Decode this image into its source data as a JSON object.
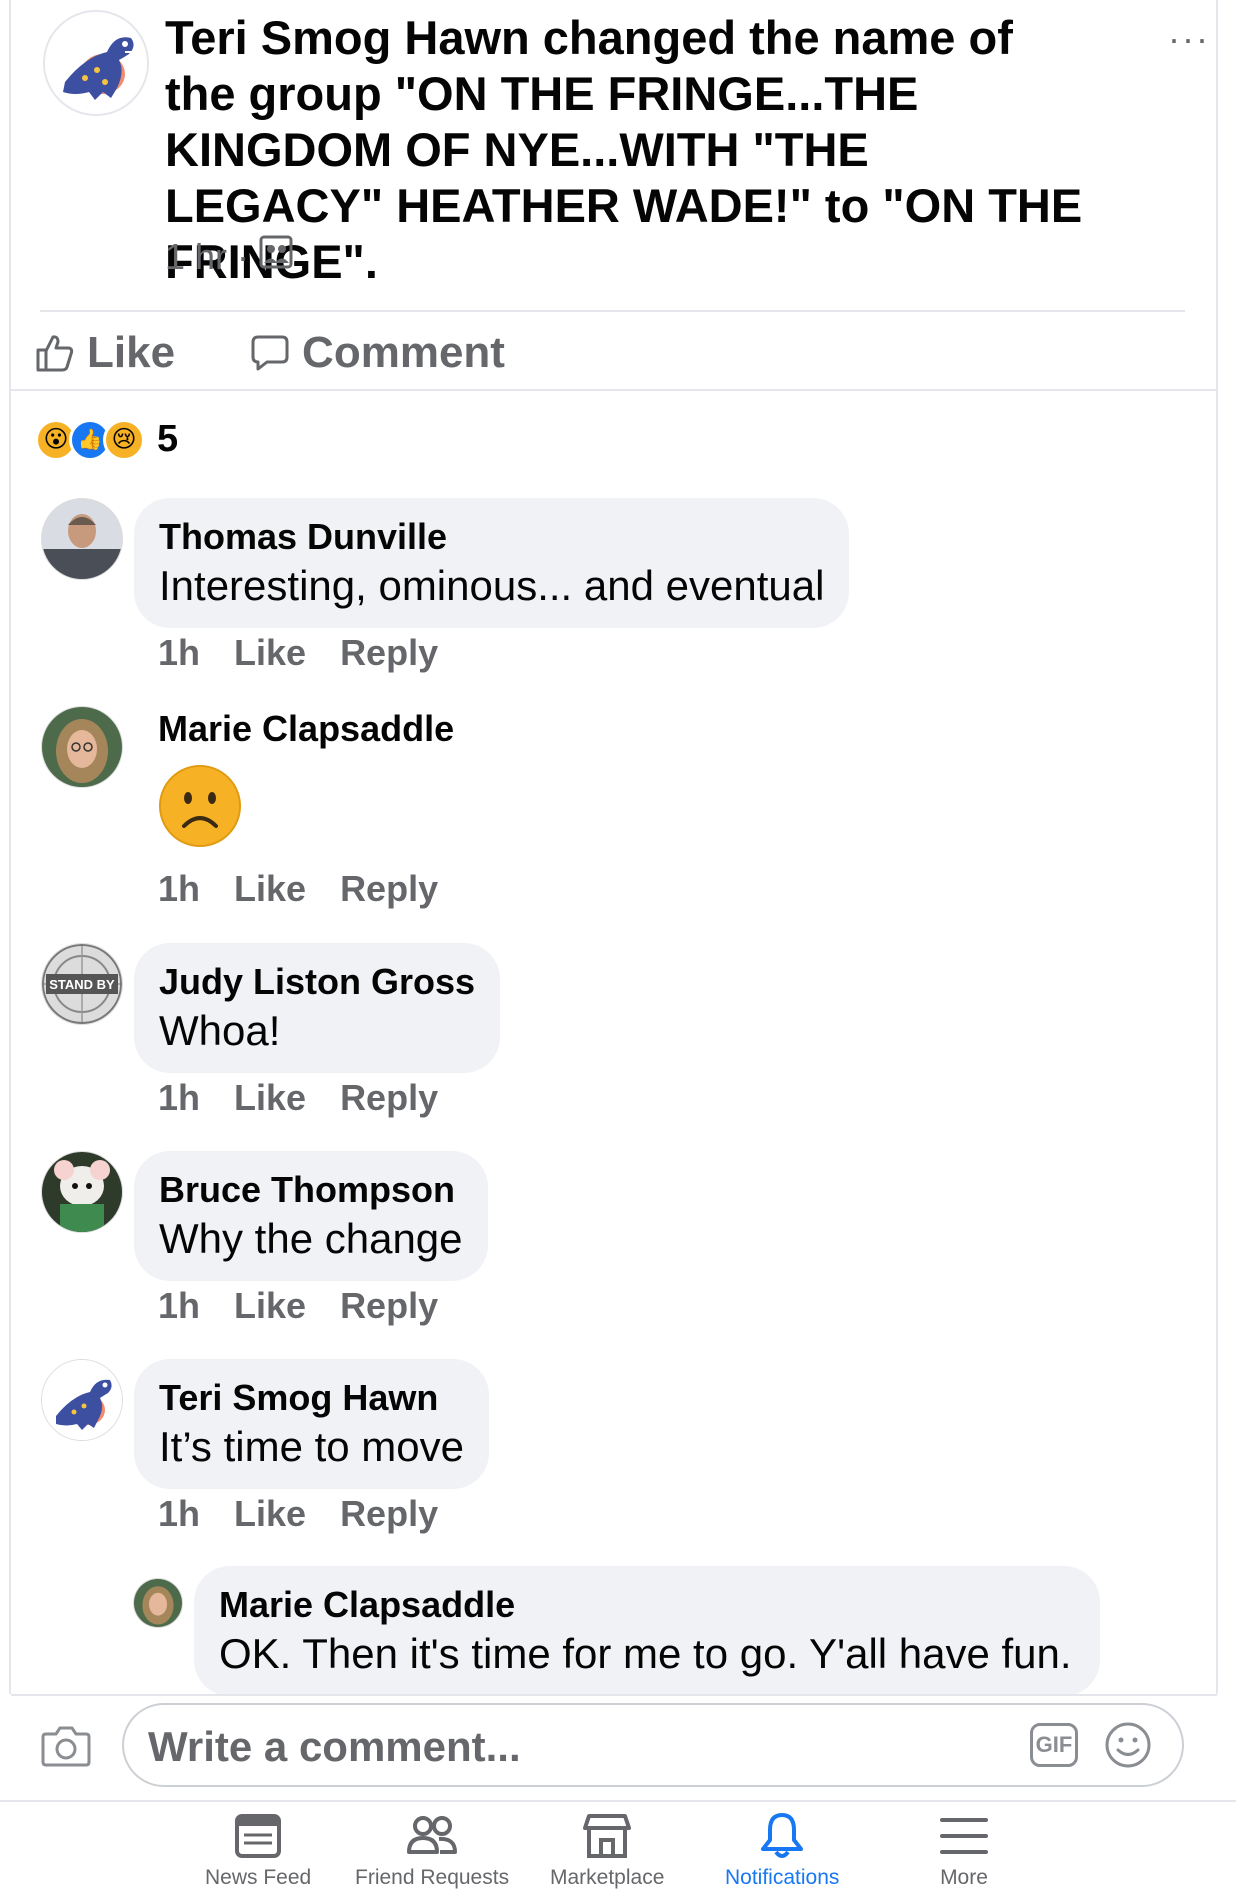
{
  "post": {
    "actor": "Teri Smog Hawn",
    "action_text": " changed the name of the group \"ON THE FRINGE...THE KINGDOM OF NYE...WITH \"THE LEGACY\" HEATHER WADE!\" to \"ON THE FRINGE\".",
    "time": "1 hr",
    "dot": "·",
    "more": "···",
    "like_label": "Like",
    "comment_label": "Comment"
  },
  "reactions": {
    "count": "5",
    "types": [
      "wow",
      "like",
      "sad"
    ]
  },
  "comments": [
    {
      "name": "Thomas Dunville",
      "text": "Interesting, ominous... and eventual",
      "time": "1h",
      "like": "Like",
      "reply": "Reply"
    },
    {
      "name": "Marie Clapsaddle",
      "text": "☹",
      "time": "1h",
      "like": "Like",
      "reply": "Reply"
    },
    {
      "name": "Judy Liston Gross",
      "text": "Whoa!",
      "time": "1h",
      "like": "Like",
      "reply": "Reply",
      "avatar_text": "STAND BY"
    },
    {
      "name": "Bruce Thompson",
      "text": "Why the change",
      "time": "1h",
      "like": "Like",
      "reply": "Reply"
    },
    {
      "name": "Teri Smog Hawn",
      "text": "It’s time to move",
      "time": "1h",
      "like": "Like",
      "reply": "Reply"
    },
    {
      "name": "Marie Clapsaddle",
      "text": "OK. Then it's time for me to go. Y'all have fun.",
      "reply_level": 1
    }
  ],
  "composer": {
    "placeholder": "Write a comment...",
    "gif_label": "GIF"
  },
  "tabbar": {
    "items": [
      {
        "label": "News Feed"
      },
      {
        "label": "Friend Requests"
      },
      {
        "label": "Marketplace"
      },
      {
        "label": "Notifications",
        "active": true
      },
      {
        "label": "More"
      }
    ]
  },
  "colors": {
    "accent": "#1877f2",
    "secondary_text": "#65676b",
    "bubble": "#f0f2f5"
  }
}
